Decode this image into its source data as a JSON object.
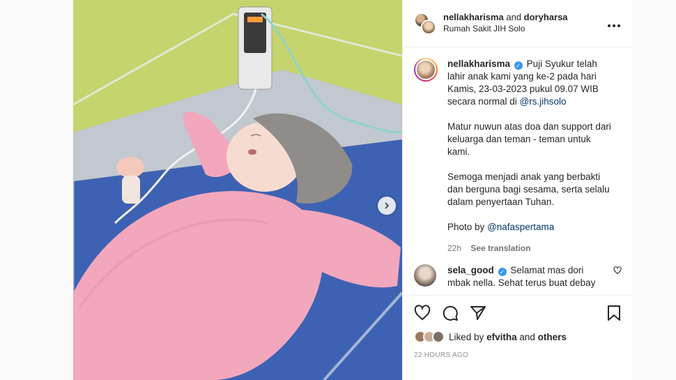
{
  "header": {
    "user1": "nellakharisma",
    "connector": "and",
    "user2": "doryharsa",
    "location": "Rumah Sakit JIH Solo",
    "more_icon": "more-horizontal-icon"
  },
  "caption": {
    "username": "nellakharisma",
    "paragraph1_pre": "Puji Syukur telah lahir anak kami yang ke-2 pada hari Kamis, 23-03-2023 pukul 09.07 WIB secara normal di",
    "paragraph1_mention": "@rs.jihsolo",
    "paragraph2": "Matur nuwun atas doa dan support dari keluarga dan teman - teman untuk kami.",
    "paragraph3": "Semoga menjadi anak yang berbakti dan berguna bagi sesama, serta selalu dalam penyertaan Tuhan.",
    "photo_by": "Photo by",
    "photo_mention": "@nafaspertama",
    "time": "22h",
    "translate": "See translation"
  },
  "comment": {
    "username": "sela_good",
    "text": "Selamat mas dori mbak nella. Sehat terus buat debay"
  },
  "likes": {
    "prefix": "Liked by",
    "user": "efvitha",
    "connector": "and",
    "others": "others"
  },
  "timestamp": "22 HOURS AGO",
  "colors": {
    "verified": "#3897f0",
    "mention": "#00376b",
    "muted": "#737373",
    "text": "#262626"
  }
}
